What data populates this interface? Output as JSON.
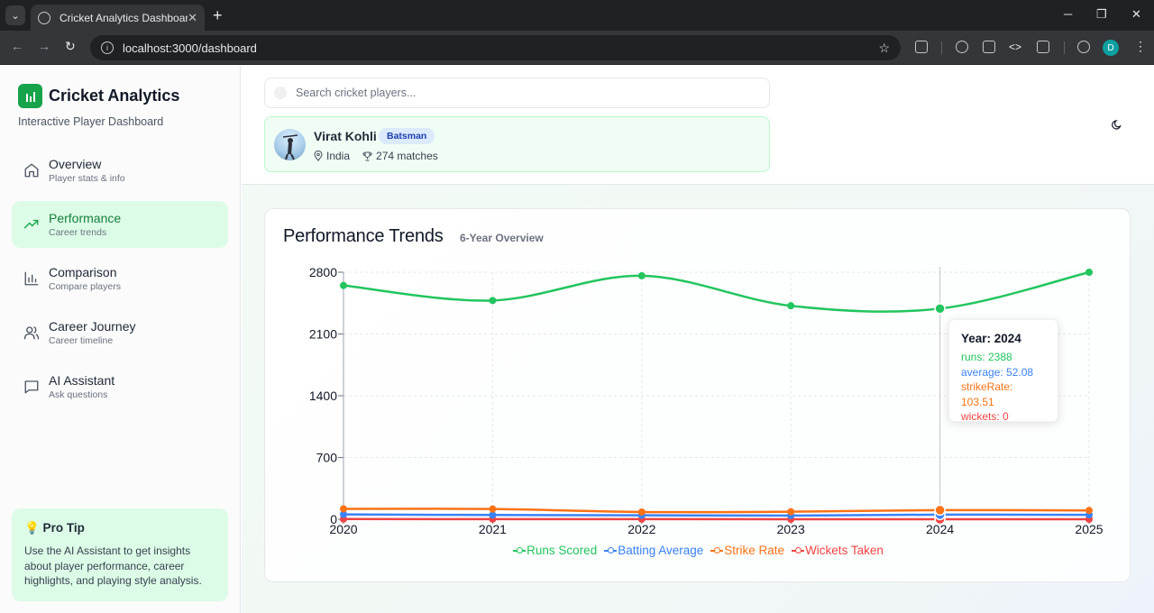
{
  "browser": {
    "tab_title": "Cricket Analytics Dashboard",
    "url": "localhost:3000/dashboard",
    "profile_initial": "D"
  },
  "sidebar": {
    "brand": "Cricket Analytics",
    "subtitle": "Interactive Player Dashboard",
    "items": [
      {
        "label": "Overview",
        "desc": "Player stats & info",
        "icon": "home-icon",
        "active": false
      },
      {
        "label": "Performance",
        "desc": "Career trends",
        "icon": "trending-up-icon",
        "active": true
      },
      {
        "label": "Comparison",
        "desc": "Compare players",
        "icon": "bar-chart-icon",
        "active": false
      },
      {
        "label": "Career Journey",
        "desc": "Career timeline",
        "icon": "users-icon",
        "active": false
      },
      {
        "label": "AI Assistant",
        "desc": "Ask questions",
        "icon": "message-icon",
        "active": false
      }
    ],
    "tip": {
      "title": "💡 Pro Tip",
      "body": "Use the AI Assistant to get insights about player performance, career highlights, and playing style analysis."
    }
  },
  "search": {
    "placeholder": "Search cricket players..."
  },
  "player": {
    "name": "Virat Kohli",
    "role": "Batsman",
    "country": "India",
    "matches": "274 matches"
  },
  "chart_header": {
    "title": "Performance Trends",
    "subtitle": "6-Year Overview"
  },
  "colors": {
    "runs": "#22c55e",
    "average": "#3b82f6",
    "strike_rate": "#f97316",
    "wickets": "#ef4444",
    "accent": "#16a34a"
  },
  "chart_data": {
    "type": "line",
    "x": [
      "2020",
      "2021",
      "2022",
      "2023",
      "2024",
      "2025"
    ],
    "ylim": [
      0,
      2800
    ],
    "yticks": [
      "0",
      "700",
      "1400",
      "2100",
      "2800"
    ],
    "grid": true,
    "legend_position": "bottom",
    "series": [
      {
        "name": "Runs Scored",
        "key": "runs",
        "values": [
          2650,
          2480,
          2760,
          2420,
          2388,
          2800
        ]
      },
      {
        "name": "Batting Average",
        "key": "average",
        "values": [
          55,
          48,
          45,
          42,
          52.08,
          50
        ]
      },
      {
        "name": "Strike Rate",
        "key": "strike_rate",
        "values": [
          118,
          116,
          82,
          85,
          103.51,
          100
        ]
      },
      {
        "name": "Wickets Taken",
        "key": "wickets",
        "values": [
          2,
          1,
          1,
          0,
          0,
          0
        ]
      }
    ],
    "tooltip": {
      "title": "Year: 2024",
      "lines": [
        "runs: 2388",
        "average: 52.08",
        "strikeRate: 103.51",
        "wickets: 0"
      ]
    }
  }
}
